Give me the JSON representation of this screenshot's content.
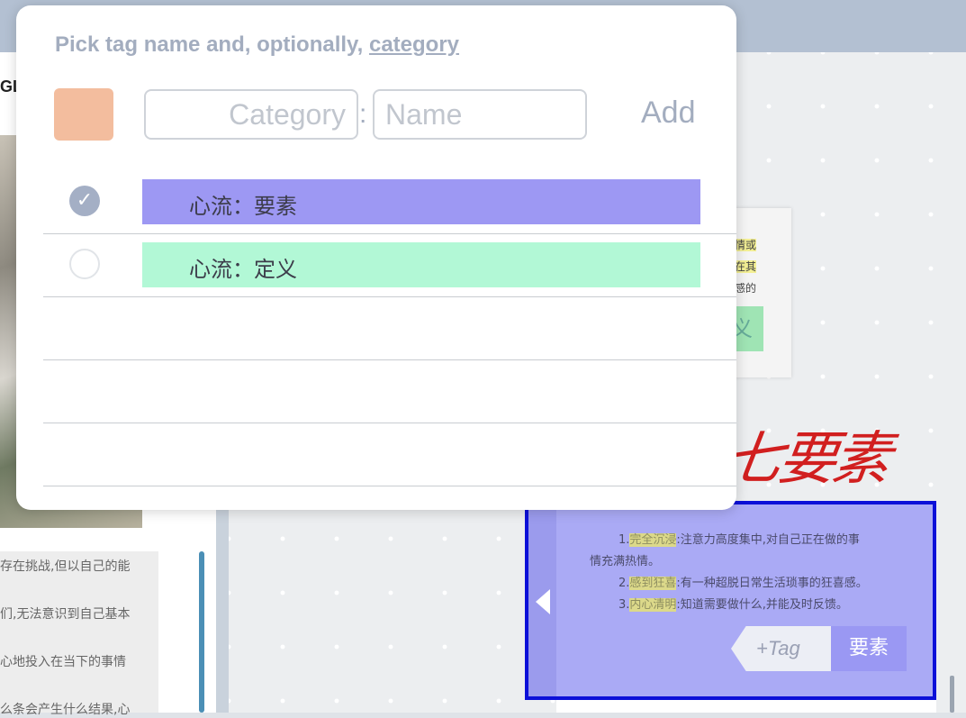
{
  "background": {
    "left_fragment": "GL",
    "left_text_lines": [
      "存在挑战,但以自己的能",
      "们,无法意识到自己基本",
      "心地投入在当下的事情",
      "么条会产生什么结果,心"
    ],
    "card_lines": [
      "情或",
      "在其",
      "感的"
    ],
    "card_tag_fragment": "义",
    "handwriting": "七要素",
    "note": {
      "line1_num": "1.",
      "line1_hl": "完全沉浸",
      "line1_rest": ":注意力高度集中,对自己正在做的事",
      "line1_cont": "情充满热情。",
      "line2_num": "2.",
      "line2_hl": "感到狂喜",
      "line2_rest": ":有一种超脱日常生活琐事的狂喜感。",
      "line3_num": "3.",
      "line3_hl": "内心清明",
      "line3_rest": ":知道需要做什么,并能及时反馈。",
      "add_tag_label": "+Tag",
      "tag_label": "要素"
    }
  },
  "popup": {
    "title_prefix": "Pick tag name and, optionally, ",
    "title_link": "category",
    "swatch_color": "#f3bd9e",
    "category_placeholder": "Category",
    "category_value": "",
    "separator": ":",
    "name_placeholder": "Name",
    "name_value": "",
    "add_label": "Add",
    "tags": [
      {
        "label": "心流：要素",
        "color": "#9d98f3",
        "checked": true
      },
      {
        "label": "心流：定义",
        "color": "#b2f8d6",
        "checked": false
      }
    ],
    "check_glyph": "✓"
  }
}
